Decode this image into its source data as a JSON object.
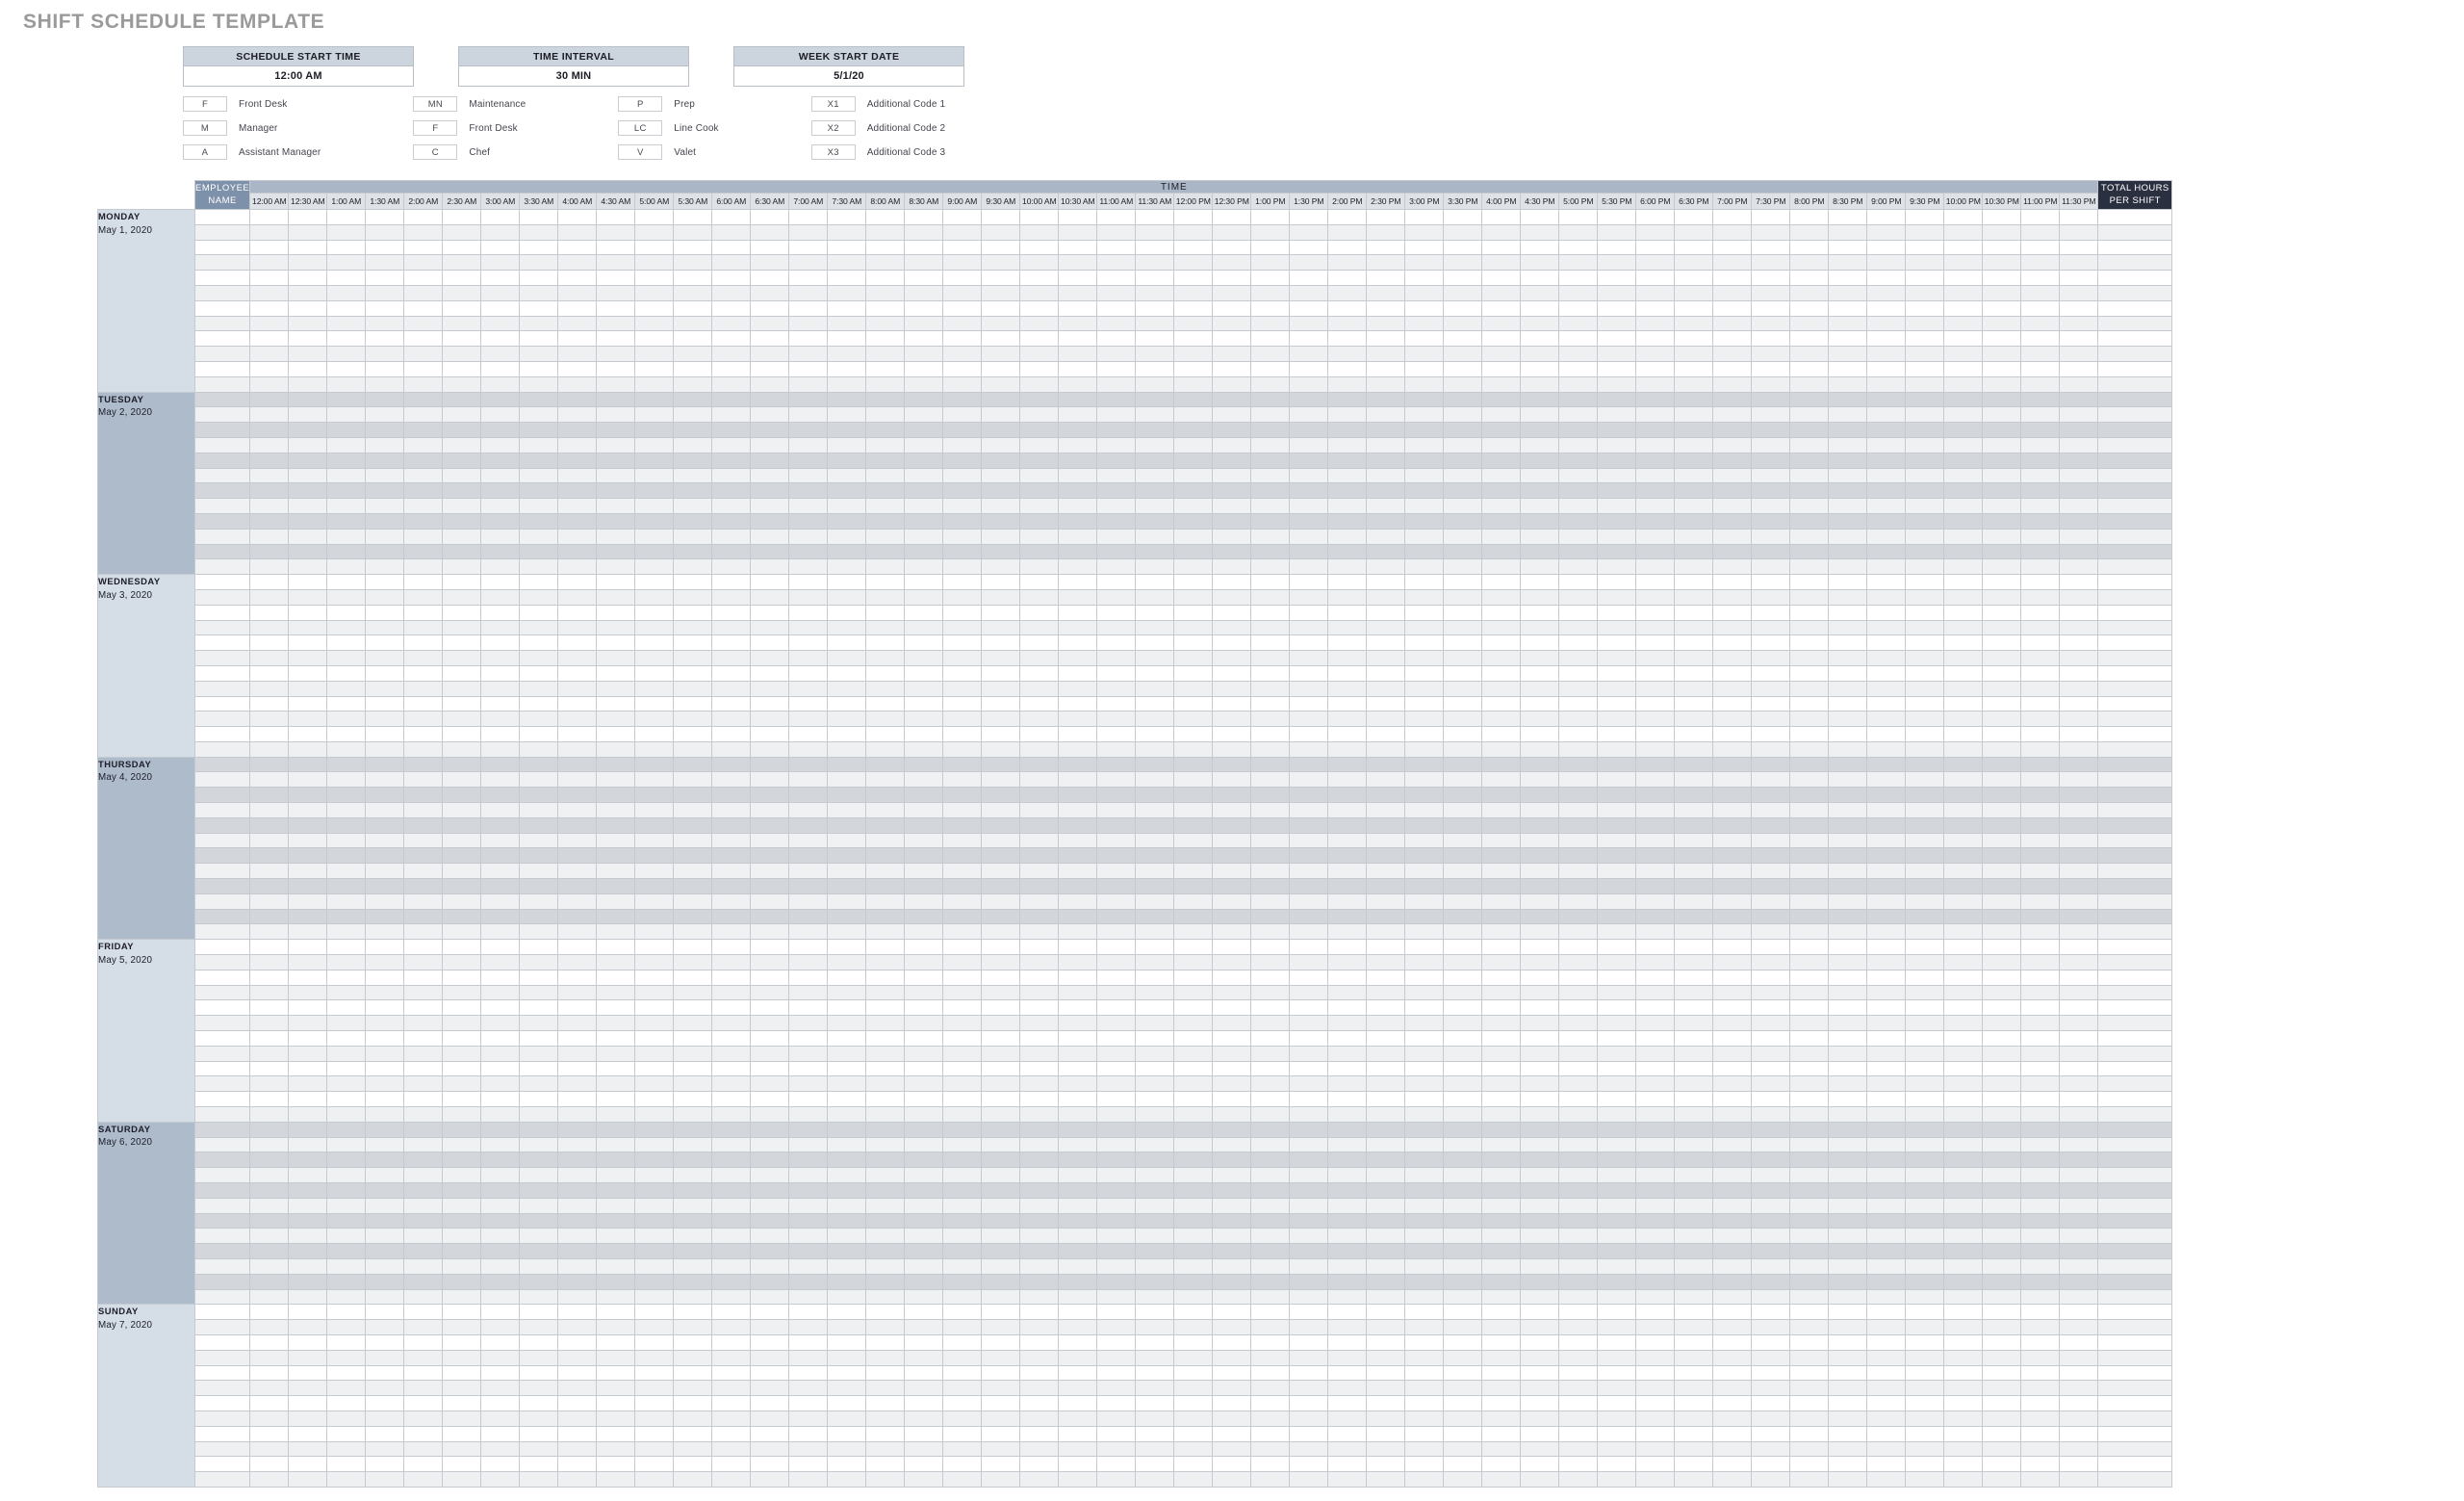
{
  "title": "SHIFT SCHEDULE TEMPLATE",
  "settings": [
    {
      "label": "SCHEDULE START TIME",
      "value": "12:00 AM"
    },
    {
      "label": "TIME INTERVAL",
      "value": "30 MIN"
    },
    {
      "label": "WEEK START DATE",
      "value": "5/1/20"
    }
  ],
  "legend": [
    [
      {
        "code": "F",
        "text": "Front Desk"
      },
      {
        "code": "M",
        "text": "Manager"
      },
      {
        "code": "A",
        "text": "Assistant Manager"
      }
    ],
    [
      {
        "code": "MN",
        "text": "Maintenance"
      },
      {
        "code": "F",
        "text": "Front Desk"
      },
      {
        "code": "C",
        "text": "Chef"
      }
    ],
    [
      {
        "code": "P",
        "text": "Prep"
      },
      {
        "code": "LC",
        "text": "Line Cook"
      },
      {
        "code": "V",
        "text": "Valet"
      }
    ],
    [
      {
        "code": "X1",
        "text": "Additional Code 1"
      },
      {
        "code": "X2",
        "text": "Additional Code 2"
      },
      {
        "code": "X3",
        "text": "Additional Code 3"
      }
    ]
  ],
  "table": {
    "time_band_label": "TIME",
    "employee_header": "EMPLOYEE NAME",
    "employee_header_line1": "EMPLOYEE",
    "employee_header_line2": "NAME",
    "total_header_line1": "TOTAL HOURS",
    "total_header_line2": "PER SHIFT",
    "total_header": "TOTAL HOURS PER SHIFT",
    "time_columns": [
      "12:00 AM",
      "12:30 AM",
      "1:00 AM",
      "1:30 AM",
      "2:00 AM",
      "2:30 AM",
      "3:00 AM",
      "3:30 AM",
      "4:00 AM",
      "4:30 AM",
      "5:00 AM",
      "5:30 AM",
      "6:00 AM",
      "6:30 AM",
      "7:00 AM",
      "7:30 AM",
      "8:00 AM",
      "8:30 AM",
      "9:00 AM",
      "9:30 AM",
      "10:00 AM",
      "10:30 AM",
      "11:00 AM",
      "11:30 AM",
      "12:00 PM",
      "12:30 PM",
      "1:00 PM",
      "1:30 PM",
      "2:00 PM",
      "2:30 PM",
      "3:00 PM",
      "3:30 PM",
      "4:00 PM",
      "4:30 PM",
      "5:00 PM",
      "5:30 PM",
      "6:00 PM",
      "6:30 PM",
      "7:00 PM",
      "7:30 PM",
      "8:00 PM",
      "8:30 PM",
      "9:00 PM",
      "9:30 PM",
      "10:00 PM",
      "10:30 PM",
      "11:00 PM",
      "11:30 PM"
    ],
    "days": [
      {
        "name": "MONDAY",
        "date": "May 1, 2020",
        "shade": "light",
        "rows": 12
      },
      {
        "name": "TUESDAY",
        "date": "May 2, 2020",
        "shade": "dark",
        "rows": 12
      },
      {
        "name": "WEDNESDAY",
        "date": "May 3, 2020",
        "shade": "light",
        "rows": 12
      },
      {
        "name": "THURSDAY",
        "date": "May 4, 2020",
        "shade": "dark",
        "rows": 12
      },
      {
        "name": "FRIDAY",
        "date": "May 5, 2020",
        "shade": "light",
        "rows": 12
      },
      {
        "name": "SATURDAY",
        "date": "May 6, 2020",
        "shade": "dark",
        "rows": 12
      },
      {
        "name": "SUNDAY",
        "date": "May 7, 2020",
        "shade": "light",
        "rows": 12
      }
    ]
  },
  "colors": {
    "title": "#9a9a9a",
    "setting_header": "#ccd4dd",
    "time_band": "#aab6c6",
    "employee_header": "#7e91ab",
    "total_header": "#2b3040",
    "time_header": "#dfe3e8",
    "day_light": "#d5dde6",
    "day_dark": "#aebbcb",
    "grid_line": "#c5cad1"
  }
}
